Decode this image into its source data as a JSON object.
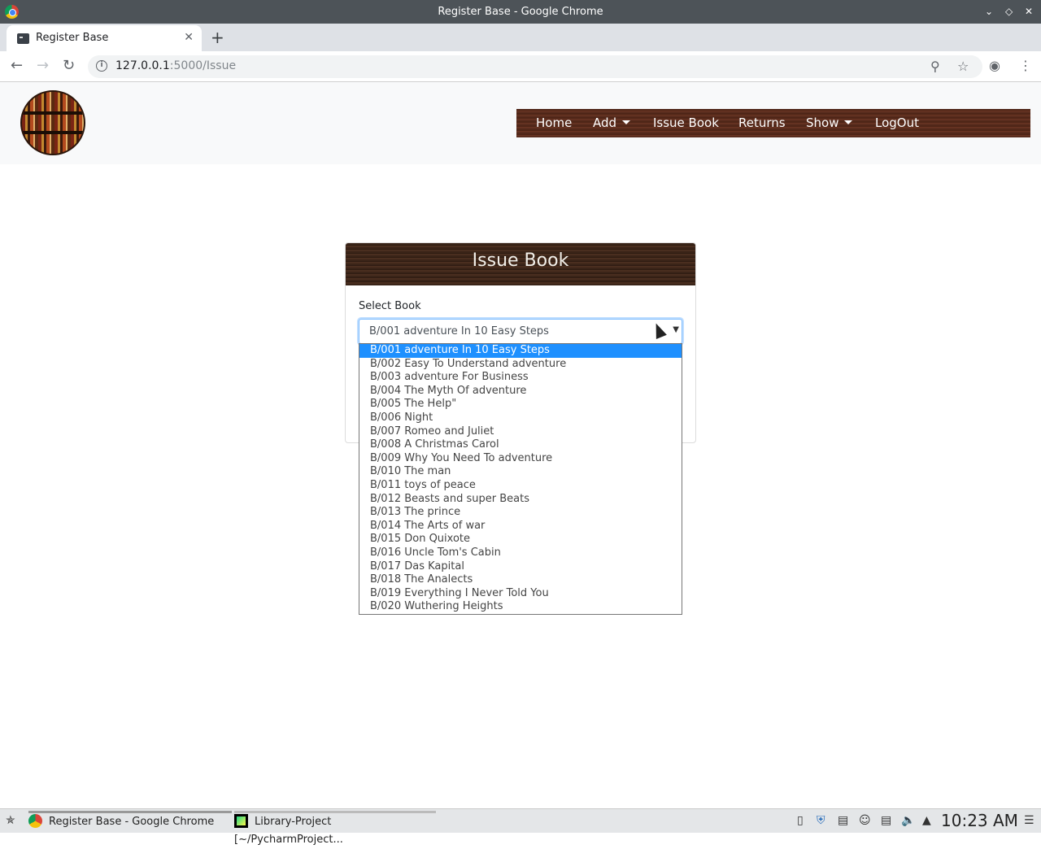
{
  "window": {
    "title": "Register Base - Google Chrome"
  },
  "browser": {
    "tab_title": "Register Base",
    "url_host": "127.0.0.1",
    "url_rest": ":5000/Issue"
  },
  "nav": {
    "home": "Home",
    "add": "Add",
    "issue_book": "Issue Book",
    "returns": "Returns",
    "show": "Show",
    "logout": "LogOut"
  },
  "card": {
    "title": "Issue Book",
    "select_label": "Select Book",
    "selected_value": "B/001 adventure In 10 Easy Steps"
  },
  "options": [
    "B/001 adventure In 10 Easy Steps",
    "B/002 Easy To Understand adventure",
    "B/003 adventure For Business",
    "B/004 The Myth Of adventure",
    "B/005 The Help\"",
    "B/006 Night",
    "B/007 Romeo and Juliet",
    "B/008 A Christmas Carol",
    "B/009 Why You Need To adventure",
    "B/010 The man",
    "B/011 toys of peace",
    "B/012 Beasts and super Beats",
    "B/013 The prince",
    "B/014 The Arts of war",
    "B/015 Don Quixote",
    "B/016 Uncle Tom's Cabin",
    "B/017 Das Kapital",
    "B/018 The Analects",
    "B/019 Everything I Never Told You",
    "B/020 Wuthering Heights"
  ],
  "taskbar": {
    "task1": "Register Base - Google Chrome",
    "task2": "Library-Project [~/PycharmProject...",
    "clock": "10:23 AM"
  },
  "colors": {
    "menu_bg": "#5a2d1e",
    "selected_option": "#1e90ff",
    "card_header": "#3a2418"
  }
}
